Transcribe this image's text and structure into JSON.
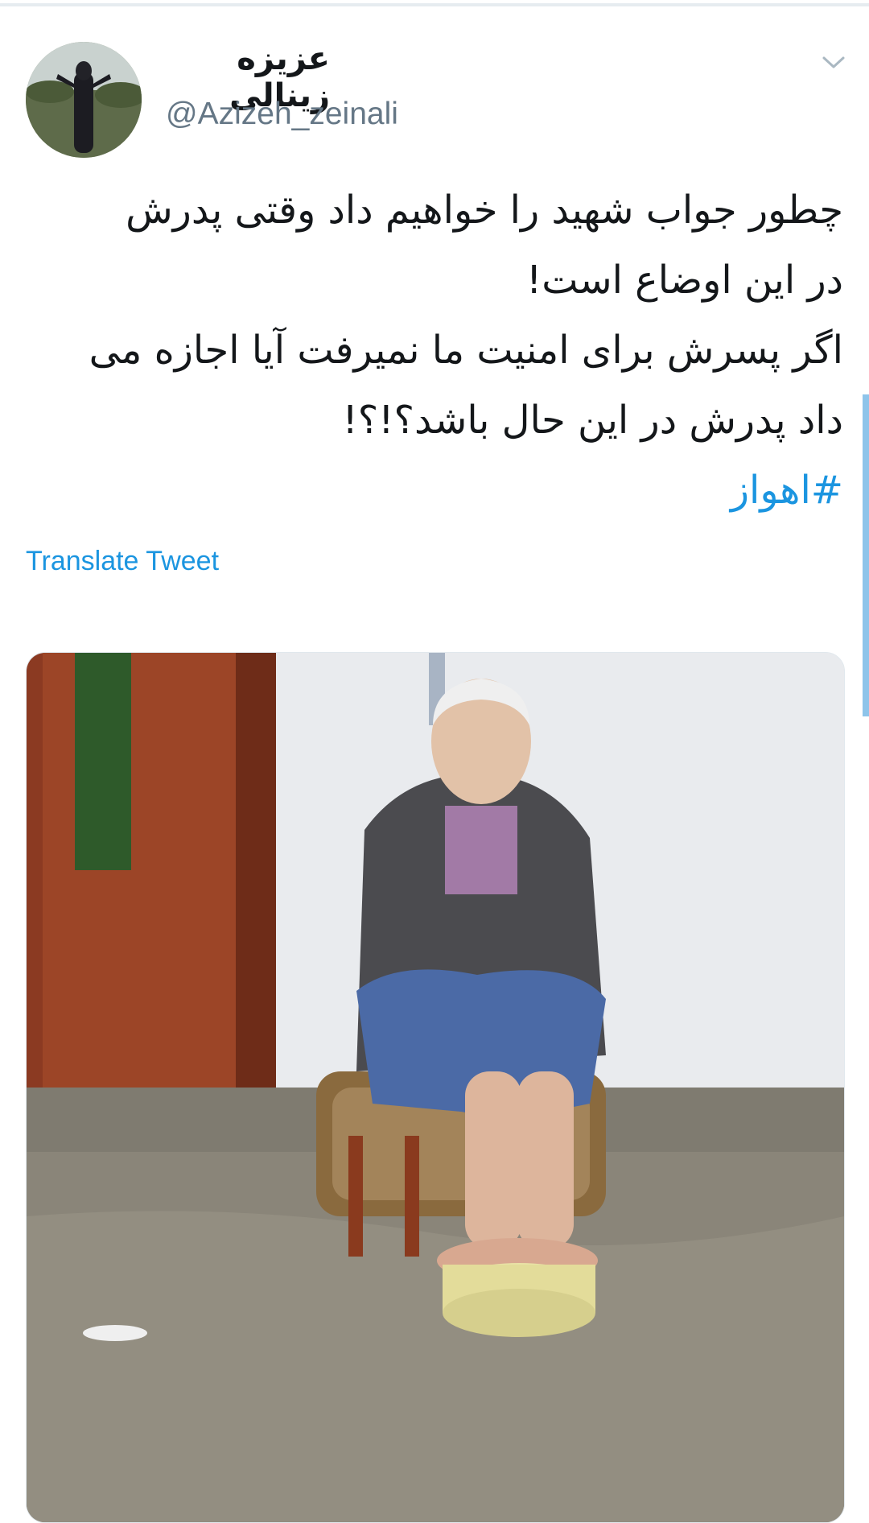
{
  "tweet": {
    "display_name": "عزیزه زینالی",
    "handle": "@Azizeh_zeinali",
    "text_lines": [
      "چطور جواب شهید را خواهیم داد وقتی پدرش",
      "در این اوضاع است!",
      "اگر پسرش برای امنیت ما نمیرفت آیا اجازه می",
      "داد پدرش در این حال باشد؟!؟!"
    ],
    "hashtag": "#اهواز",
    "translate_label": "Translate Tweet"
  },
  "icons": {
    "caret": "chevron-down-icon",
    "avatar": "avatar-photo"
  },
  "colors": {
    "link": "#1b95e0",
    "text": "#14171a",
    "secondary": "#657786",
    "divider": "#e6ecf0"
  }
}
